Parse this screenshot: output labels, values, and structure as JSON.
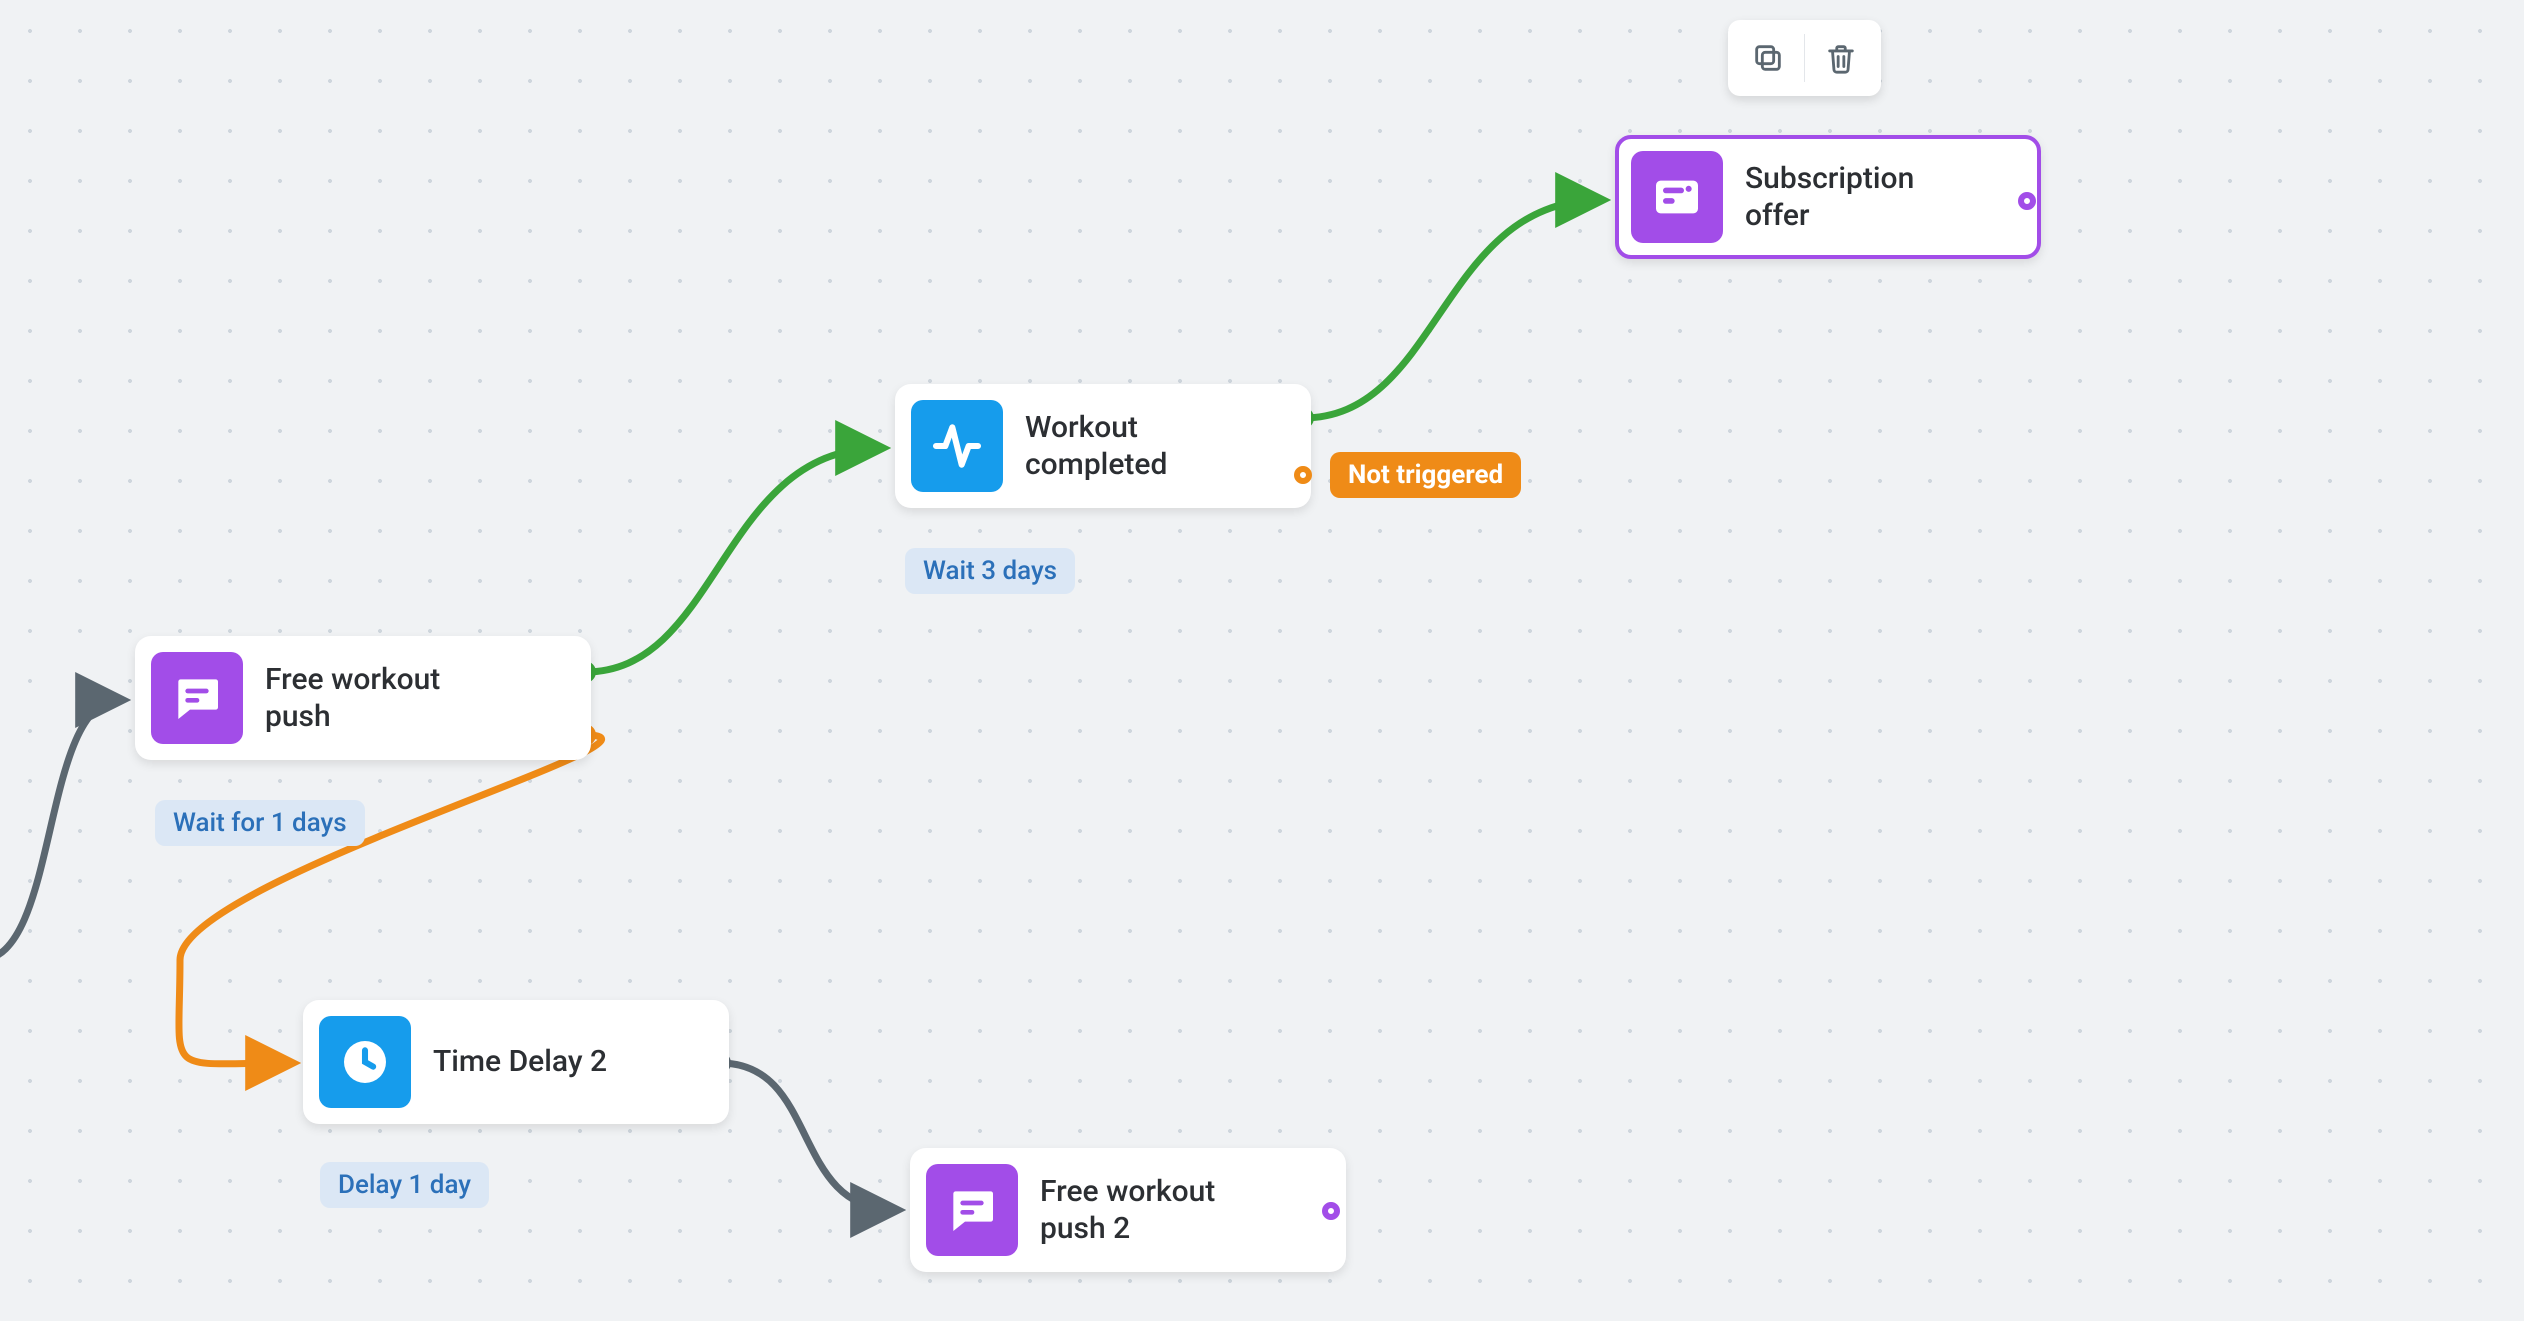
{
  "colors": {
    "purple": "#a24de8",
    "blue": "#169cec",
    "orange": "#ef8b17",
    "green": "#3aa53a",
    "gray": "#5b6770"
  },
  "toolbar": {
    "duplicate_tooltip": "Duplicate",
    "delete_tooltip": "Delete"
  },
  "nodes": {
    "free_push": {
      "label": "Free workout push",
      "sub": "Wait for 1 days",
      "type": "message"
    },
    "workout_done": {
      "label": "Workout completed",
      "sub": "Wait 3 days",
      "type": "event",
      "false_branch_label": "Not triggered"
    },
    "sub_offer": {
      "label": "Subscription offer",
      "type": "message",
      "selected": true
    },
    "delay2": {
      "label": "Time Delay 2",
      "sub": "Delay 1 day",
      "type": "delay"
    },
    "free_push2": {
      "label": "Free workout push 2",
      "type": "message"
    }
  }
}
